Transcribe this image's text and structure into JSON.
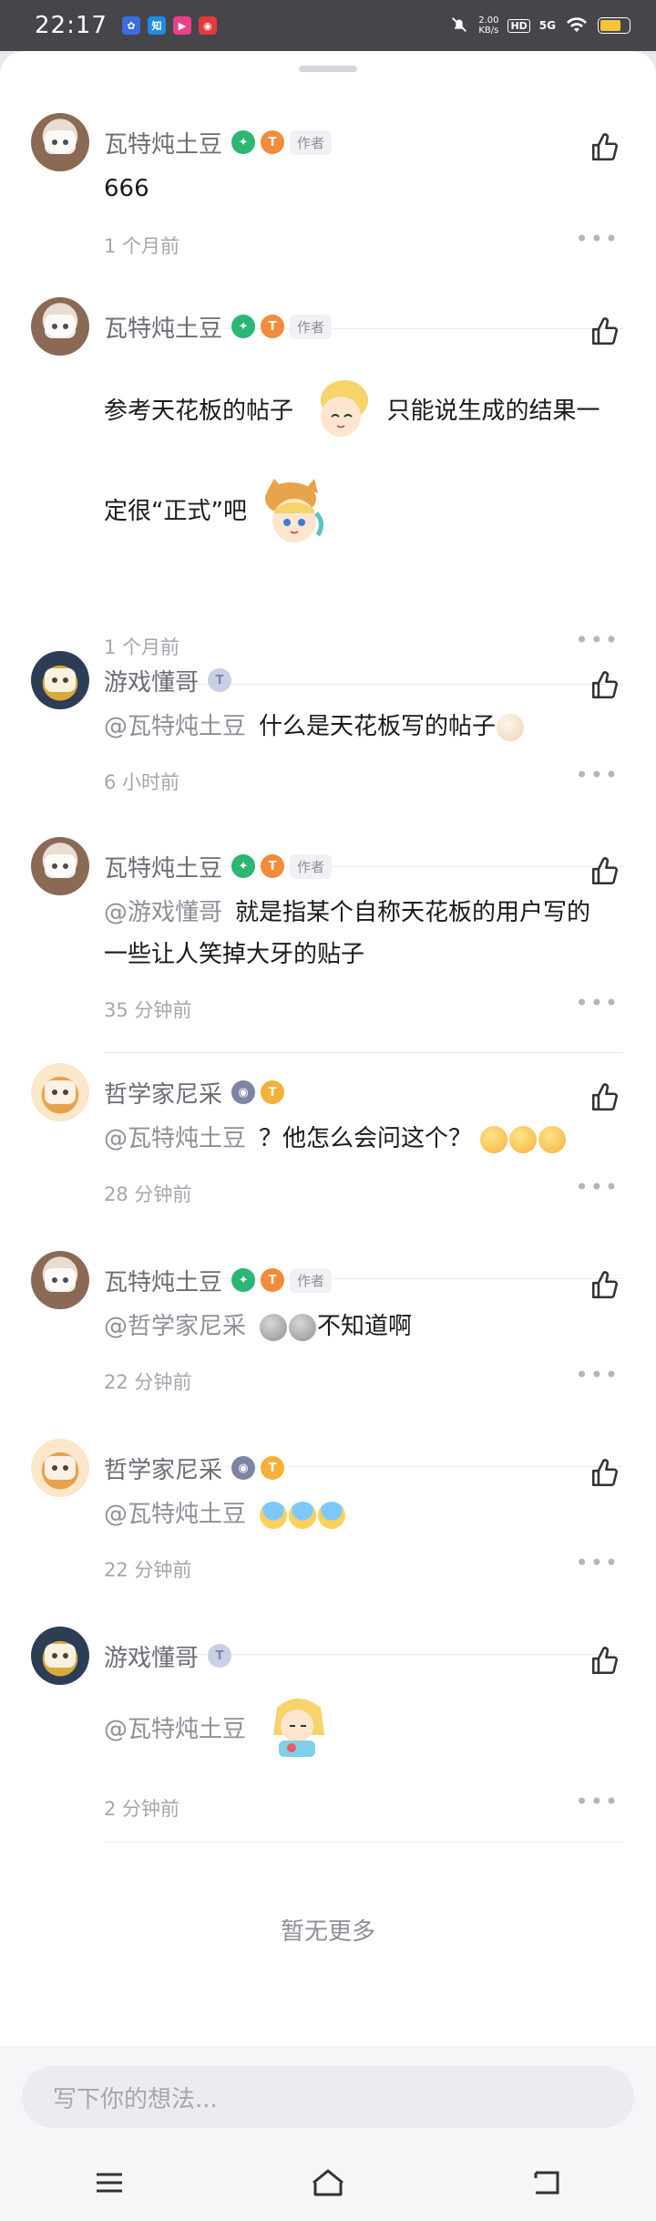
{
  "status": {
    "time": "22:17",
    "speed_top": "2.00",
    "speed_unit": "KB/s",
    "hd": "HD",
    "network": "5G"
  },
  "comments": [
    {
      "name": "瓦特炖土豆",
      "author_tag": "作者",
      "badge_t": "T",
      "at": "",
      "text": "666",
      "time": "1 个月前"
    },
    {
      "name": "瓦特炖土豆",
      "author_tag": "作者",
      "badge_t": "T",
      "at": "",
      "text1": "参考天花板的帖子",
      "text2": "只能说生成的结果一",
      "text3": "定很“正式”吧",
      "time": "1 个月前"
    },
    {
      "name": "游戏懂哥",
      "badge_t": "T",
      "at": "@瓦特炖土豆",
      "text": "什么是天花板写的帖子",
      "time": "6 小时前"
    },
    {
      "name": "瓦特炖土豆",
      "author_tag": "作者",
      "badge_t": "T",
      "at": "@游戏懂哥",
      "text1": "就是指某个自称天花板的用户写的",
      "text2": "一些让人笑掉大牙的贴子",
      "time": "35 分钟前"
    },
    {
      "name": "哲学家尼采",
      "badge_t": "T",
      "at": "@瓦特炖土豆",
      "text": "？他怎么会问这个？",
      "time": "28 分钟前"
    },
    {
      "name": "瓦特炖土豆",
      "author_tag": "作者",
      "badge_t": "T",
      "at": "@哲学家尼采",
      "text": "不知道啊",
      "time": "22 分钟前"
    },
    {
      "name": "哲学家尼采",
      "badge_t": "T",
      "at": "@瓦特炖土豆",
      "text": "",
      "time": "22 分钟前"
    },
    {
      "name": "游戏懂哥",
      "badge_t": "T",
      "at": "@瓦特炖土豆",
      "text": "",
      "time": "2 分钟前"
    }
  ],
  "more_label": "•••",
  "no_more": "暂无更多",
  "input_placeholder": "写下你的想法...",
  "colors": {
    "accent_green": "#2bb673",
    "accent_orange": "#f28b3b",
    "muted": "#8d9099"
  }
}
